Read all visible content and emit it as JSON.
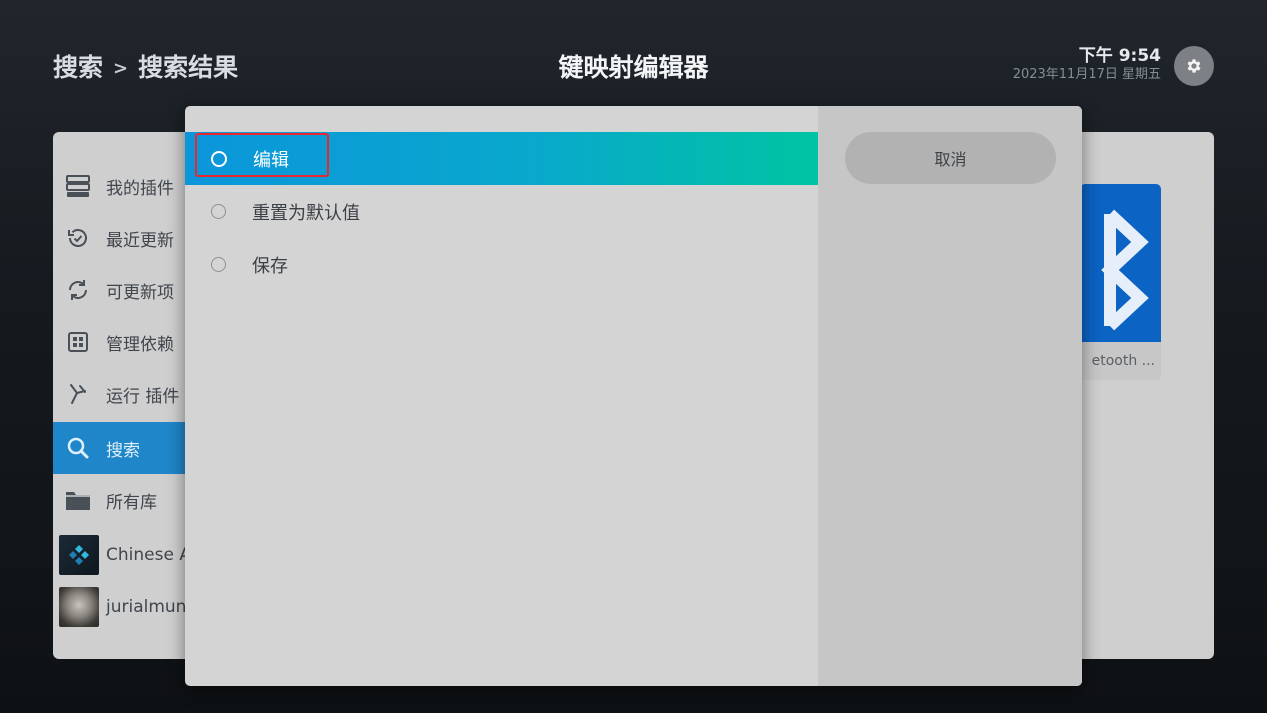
{
  "header": {
    "breadcrumb": [
      "搜索",
      "搜索结果"
    ],
    "separator": ">",
    "title": "键映射编辑器",
    "time": "下午 9:54",
    "date": "2023年11月17日 星期五",
    "settings_icon": "gear-icon"
  },
  "sidebar": {
    "items": [
      {
        "label": "我的插件",
        "icon": "drawer-icon"
      },
      {
        "label": "最近更新",
        "icon": "history-icon"
      },
      {
        "label": "可更新项",
        "icon": "refresh-icon"
      },
      {
        "label": "管理依赖",
        "icon": "dependencies-icon"
      },
      {
        "label": "运行 插件",
        "icon": "run-icon"
      },
      {
        "label": "搜索",
        "icon": "search-icon",
        "active": true
      },
      {
        "label": "所有库",
        "icon": "folder-icon"
      },
      {
        "label": "Chinese A",
        "icon": "kodi-thumbnail"
      },
      {
        "label": "jurialmunk",
        "icon": "avatar-thumbnail"
      }
    ]
  },
  "addon_card": {
    "label": "etooth ...",
    "icon": "bluetooth-icon",
    "color": "#0b63c3"
  },
  "dialog": {
    "options": [
      {
        "label": "编辑",
        "selected": true
      },
      {
        "label": "重置为默认值",
        "selected": false
      },
      {
        "label": "保存",
        "selected": false
      }
    ],
    "cancel_label": "取消",
    "accent_gradient": [
      "#0b96db",
      "#00c4a2"
    ],
    "highlight_color": "#e8282e"
  }
}
